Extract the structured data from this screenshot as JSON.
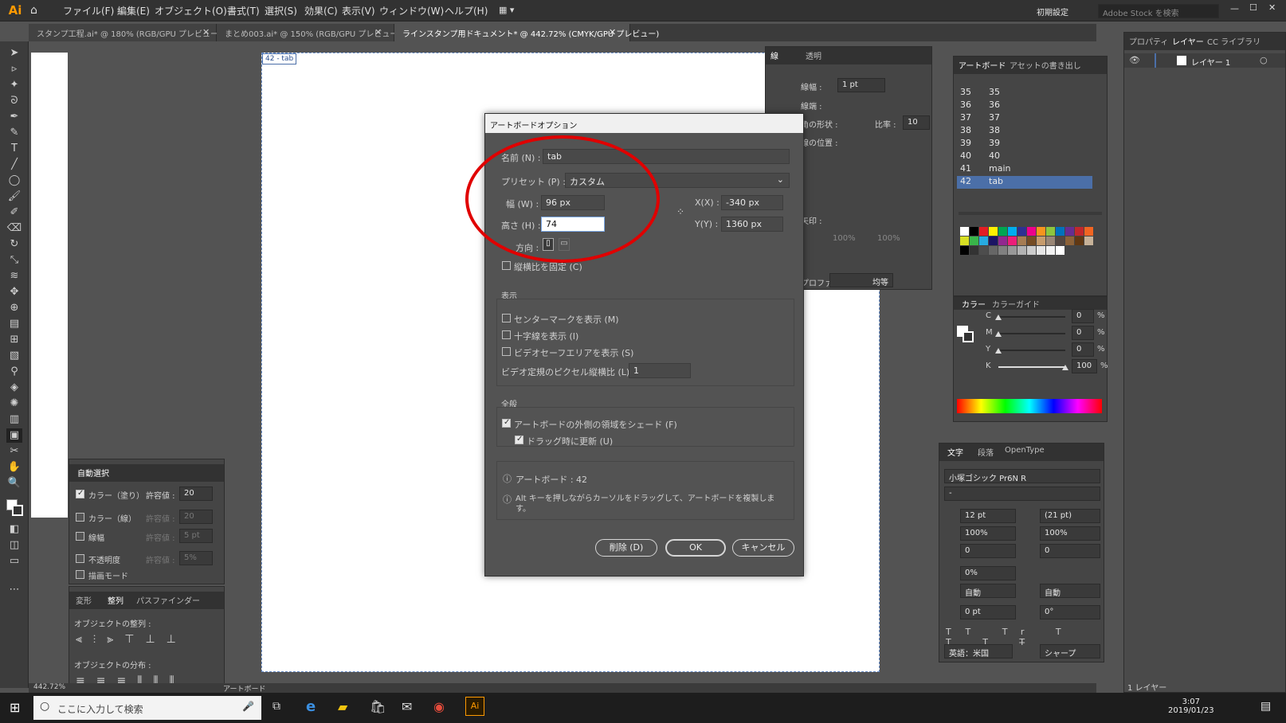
{
  "app": {
    "logo": "Ai",
    "menus": [
      "ファイル(F)",
      "編集(E)",
      "オブジェクト(O)",
      "書式(T)",
      "選択(S)",
      "効果(C)",
      "表示(V)",
      "ウィンドウ(W)",
      "ヘルプ(H)"
    ],
    "workspace": "初期設定",
    "search_placeholder": "Adobe Stock を検索"
  },
  "tabs": [
    {
      "label": "スタンプ工程.ai* @ 180% (RGB/GPU プレビュー)"
    },
    {
      "label": "まとめ003.ai* @ 150% (RGB/GPU プレビュー)"
    },
    {
      "label": "ラインスタンプ用ドキュメント* @ 442.72% (CMYK/GPU プレビュー)"
    }
  ],
  "canvas": {
    "artboard_tag": "42 - tab",
    "zoom": "442.72%",
    "status_label": "アートボード"
  },
  "stroke_panel": {
    "tabs": [
      "線",
      "透明"
    ],
    "weight_label": "線幅 :",
    "weight_value": "1 pt",
    "cap_label": "線端 :",
    "shape_label": "角の形状 :",
    "ratio_label": "比率 :",
    "ratio_value": "10",
    "align_label": "線の位置 :",
    "arrow_label": "矢印 :",
    "percent_a": "100%",
    "percent_b": "100%",
    "profile_label": "プロファイル :",
    "profile_value": "均等"
  },
  "artboards_panel": {
    "tabs": [
      "アートボード",
      "アセットの書き出し"
    ],
    "rows": [
      {
        "num": "35",
        "name": "35"
      },
      {
        "num": "36",
        "name": "36"
      },
      {
        "num": "37",
        "name": "37"
      },
      {
        "num": "38",
        "name": "38"
      },
      {
        "num": "39",
        "name": "39"
      },
      {
        "num": "40",
        "name": "40"
      },
      {
        "num": "41",
        "name": "main"
      },
      {
        "num": "42",
        "name": "tab"
      }
    ]
  },
  "color_panel": {
    "tabs": [
      "カラー",
      "カラーガイド"
    ],
    "channels": [
      {
        "label": "C",
        "value": "0",
        "fill": 0
      },
      {
        "label": "M",
        "value": "0",
        "fill": 0
      },
      {
        "label": "Y",
        "value": "0",
        "fill": 0
      },
      {
        "label": "K",
        "value": "100",
        "fill": 1
      }
    ],
    "unit": "%"
  },
  "layers_panel": {
    "tabs": [
      "プロパティ",
      "レイヤー",
      "CC ライブラリ"
    ],
    "layer_name": "レイヤー 1",
    "footer": "1 レイヤー"
  },
  "magic_wand_panel": {
    "title": "自動選択",
    "rows": [
      {
        "label": "カラー（塗り）",
        "sub": "許容値 :",
        "value": "20",
        "checked": true
      },
      {
        "label": "カラー（線）",
        "sub": "許容値 :",
        "value": "20",
        "checked": false
      },
      {
        "label": "線幅",
        "sub": "許容値 :",
        "value": "5 pt",
        "checked": false
      },
      {
        "label": "不透明度",
        "sub": "許容値 :",
        "value": "5%",
        "checked": false
      },
      {
        "label": "描画モード",
        "sub": "",
        "value": "",
        "checked": false
      }
    ]
  },
  "align_panel": {
    "tabs": [
      "変形",
      "整列",
      "パスファインダー"
    ],
    "align_label": "オブジェクトの整列 :",
    "distribute_label": "オブジェクトの分布 :"
  },
  "character_panel": {
    "tabs": [
      "文字",
      "段落",
      "OpenType"
    ],
    "font": "小塚ゴシック Pr6N R",
    "style": "-",
    "size": "12 pt",
    "leading": "(21 pt)",
    "vscale": "100%",
    "hscale": "100%",
    "kerning": "0",
    "tracking": "0",
    "tsume": "0%",
    "aki_left": "自動",
    "aki_right": "自動",
    "baseline": "0 pt",
    "rotation": "0°",
    "language": "英語：米国",
    "antialias": "シャープ"
  },
  "dialog": {
    "title": "アートボードオプション",
    "name_label": "名前 (N) :",
    "name_value": "tab",
    "preset_label": "プリセット (P) :",
    "preset_value": "カスタム",
    "width_label": "幅 (W) :",
    "width_value": "96 px",
    "height_label": "高さ (H) :",
    "height_value": "74",
    "x_label": "X(X) :",
    "x_value": "-340 px",
    "y_label": "Y(Y) :",
    "y_value": "1360 px",
    "orientation_label": "方向 :",
    "constrain_label": "縦横比を固定 (C)",
    "display_heading": "表示",
    "center_mark": "センターマークを表示 (M)",
    "cross_hairs": "十字線を表示 (I)",
    "video_safe": "ビデオセーフエリアを表示 (S)",
    "pixel_ratio_label": "ビデオ定規のピクセル縦横比 (L) :",
    "pixel_ratio_value": "1",
    "general_heading": "全般",
    "shade_outside": "アートボードの外側の領域をシェード (F)",
    "update_drag": "ドラッグ時に更新 (U)",
    "info_artboard": "アートボード : 42",
    "info_alt": "Alt キーを押しながらカーソルをドラッグして、アートボードを複製します。",
    "delete_btn": "削除 (D)",
    "ok_btn": "OK",
    "cancel_btn": "キャンセル"
  },
  "taskbar": {
    "search_placeholder": "ここに入力して検索",
    "time": "3:07",
    "date": "2019/01/23"
  },
  "colors": {
    "accent": "#ff9a00",
    "highlight_ellipse": "#e00000",
    "selection_blue": "#4b6fa8"
  }
}
